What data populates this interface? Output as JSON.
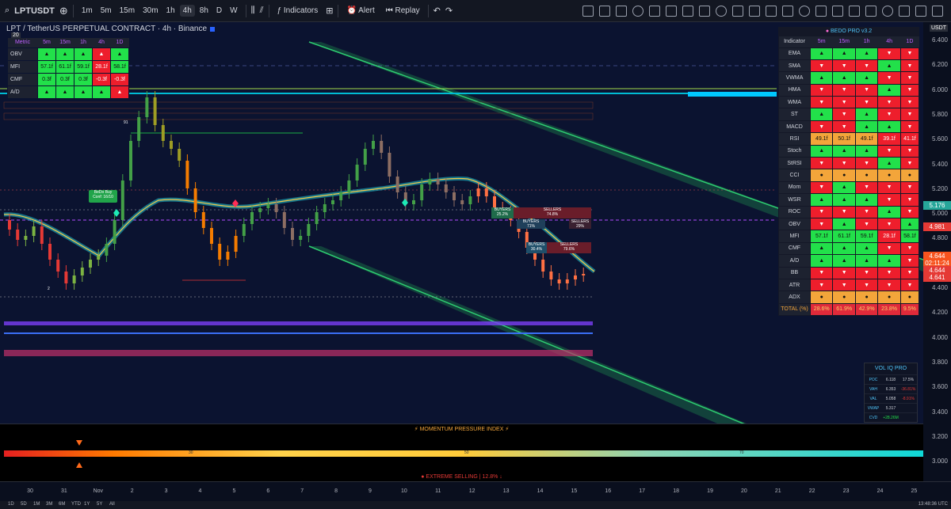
{
  "toolbar": {
    "symbol": "LPTUSDT",
    "intervals": [
      "1m",
      "5m",
      "15m",
      "30m",
      "1h",
      "4h",
      "8h",
      "D",
      "W"
    ],
    "active_interval": "4h",
    "indicators_label": "Indicators",
    "alert_label": "Alert",
    "replay_label": "Replay"
  },
  "chart": {
    "title": "LPT / TetherUS PERPETUAL CONTRACT · 4h · Binance",
    "annotations": {
      "bedo_buy": "BeDo Buy",
      "bedo_conf": "Conf: 16/10",
      "label_91": "91",
      "label_2": "2",
      "buyers_1": "BUYERS",
      "buyers_1_pct": "25.2%",
      "sellers_1": "SELLERS",
      "sellers_1_pct": "74.8%",
      "buyers_2": "BUYERS",
      "buyers_2_pct": "71%",
      "sellers_2": "SELLERS",
      "sellers_2_pct": "29%",
      "buyers_3": "BUYERS",
      "buyers_3_pct": "30.4%",
      "sellers_3": "SELLERS",
      "sellers_3_pct": "79.6%"
    }
  },
  "mini_table": {
    "z_label": "20",
    "header": [
      "Metric",
      "5m",
      "15m",
      "1h",
      "4h",
      "1D"
    ],
    "rows": [
      {
        "label": "OBV",
        "cells": [
          [
            "▲",
            "g"
          ],
          [
            "▲",
            "g"
          ],
          [
            "▲",
            "g"
          ],
          [
            "▲",
            "r"
          ],
          [
            "▲",
            "g"
          ]
        ]
      },
      {
        "label": "MFI",
        "cells": [
          [
            "57.1f",
            "g"
          ],
          [
            "61.1f",
            "g"
          ],
          [
            "59.1f",
            "g"
          ],
          [
            "28.1f",
            "r"
          ],
          [
            "58.1f",
            "g"
          ]
        ]
      },
      {
        "label": "CMF",
        "cells": [
          [
            "0.3f",
            "g"
          ],
          [
            "0.3f",
            "g"
          ],
          [
            "0.3f",
            "g"
          ],
          [
            "-0.3f",
            "r"
          ],
          [
            "-0.3f",
            "r"
          ]
        ]
      },
      {
        "label": "A/D",
        "cells": [
          [
            "▲",
            "g"
          ],
          [
            "▲",
            "g"
          ],
          [
            "▲",
            "g"
          ],
          [
            "▲",
            "g"
          ],
          [
            "▲",
            "r"
          ]
        ]
      }
    ]
  },
  "bedo": {
    "title": "BEDO PRO  v3.2",
    "header": [
      "Indicator",
      "5m",
      "15m",
      "1h",
      "4h",
      "1D"
    ],
    "rows": [
      {
        "label": "EMA",
        "cells": [
          [
            "▲",
            "g"
          ],
          [
            "▲",
            "g"
          ],
          [
            "▲",
            "g"
          ],
          [
            "▼",
            "r"
          ],
          [
            "▼",
            "r"
          ]
        ]
      },
      {
        "label": "SMA",
        "cells": [
          [
            "▼",
            "r"
          ],
          [
            "▼",
            "r"
          ],
          [
            "▼",
            "r"
          ],
          [
            "▲",
            "g"
          ],
          [
            "▼",
            "r"
          ]
        ]
      },
      {
        "label": "VWMA",
        "cells": [
          [
            "▲",
            "g"
          ],
          [
            "▲",
            "g"
          ],
          [
            "▲",
            "g"
          ],
          [
            "▼",
            "r"
          ],
          [
            "▼",
            "r"
          ]
        ]
      },
      {
        "label": "HMA",
        "cells": [
          [
            "▼",
            "r"
          ],
          [
            "▼",
            "r"
          ],
          [
            "▼",
            "r"
          ],
          [
            "▲",
            "g"
          ],
          [
            "▼",
            "r"
          ]
        ]
      },
      {
        "label": "WMA",
        "cells": [
          [
            "▼",
            "r"
          ],
          [
            "▼",
            "r"
          ],
          [
            "▼",
            "r"
          ],
          [
            "▼",
            "r"
          ],
          [
            "▼",
            "r"
          ]
        ]
      },
      {
        "label": "ST",
        "cells": [
          [
            "▲",
            "g"
          ],
          [
            "▼",
            "r"
          ],
          [
            "▲",
            "g"
          ],
          [
            "▼",
            "r"
          ],
          [
            "▼",
            "r"
          ]
        ]
      },
      {
        "label": "MACD",
        "cells": [
          [
            "▼",
            "r"
          ],
          [
            "▼",
            "r"
          ],
          [
            "▲",
            "g"
          ],
          [
            "▲",
            "g"
          ],
          [
            "▼",
            "r"
          ]
        ]
      },
      {
        "label": "RSI",
        "cells": [
          [
            "49.1f",
            "o"
          ],
          [
            "50.1f",
            "o"
          ],
          [
            "49.1f",
            "o"
          ],
          [
            "39.1f",
            "r"
          ],
          [
            "41.1f",
            "r"
          ]
        ]
      },
      {
        "label": "Stoch",
        "cells": [
          [
            "▲",
            "g"
          ],
          [
            "▲",
            "g"
          ],
          [
            "▲",
            "g"
          ],
          [
            "▼",
            "r"
          ],
          [
            "▼",
            "r"
          ]
        ]
      },
      {
        "label": "StRSI",
        "cells": [
          [
            "▼",
            "r"
          ],
          [
            "▼",
            "r"
          ],
          [
            "▼",
            "r"
          ],
          [
            "▲",
            "g"
          ],
          [
            "▼",
            "r"
          ]
        ]
      },
      {
        "label": "CCI",
        "cells": [
          [
            "●",
            "o"
          ],
          [
            "●",
            "o"
          ],
          [
            "●",
            "o"
          ],
          [
            "●",
            "o"
          ],
          [
            "●",
            "o"
          ]
        ]
      },
      {
        "label": "Mom",
        "cells": [
          [
            "▼",
            "r"
          ],
          [
            "▲",
            "g"
          ],
          [
            "▼",
            "r"
          ],
          [
            "▼",
            "r"
          ],
          [
            "▼",
            "r"
          ]
        ]
      },
      {
        "label": "WSR",
        "cells": [
          [
            "▲",
            "g"
          ],
          [
            "▲",
            "g"
          ],
          [
            "▲",
            "g"
          ],
          [
            "▼",
            "r"
          ],
          [
            "▼",
            "r"
          ]
        ]
      },
      {
        "label": "ROC",
        "cells": [
          [
            "▼",
            "r"
          ],
          [
            "▼",
            "r"
          ],
          [
            "▼",
            "r"
          ],
          [
            "▲",
            "g"
          ],
          [
            "▼",
            "r"
          ]
        ]
      },
      {
        "label": "OBV",
        "cells": [
          [
            "▼",
            "r"
          ],
          [
            "▲",
            "g"
          ],
          [
            "▼",
            "r"
          ],
          [
            "▼",
            "r"
          ],
          [
            "▲",
            "g"
          ]
        ]
      },
      {
        "label": "MFI",
        "cells": [
          [
            "57.1f",
            "g"
          ],
          [
            "61.1f",
            "g"
          ],
          [
            "59.1f",
            "g"
          ],
          [
            "28.1f",
            "r"
          ],
          [
            "58.1f",
            "g"
          ]
        ]
      },
      {
        "label": "CMF",
        "cells": [
          [
            "▲",
            "g"
          ],
          [
            "▲",
            "g"
          ],
          [
            "▲",
            "g"
          ],
          [
            "▼",
            "r"
          ],
          [
            "▼",
            "r"
          ]
        ]
      },
      {
        "label": "A/D",
        "cells": [
          [
            "▲",
            "g"
          ],
          [
            "▲",
            "g"
          ],
          [
            "▲",
            "g"
          ],
          [
            "▲",
            "g"
          ],
          [
            "▼",
            "r"
          ]
        ]
      },
      {
        "label": "BB",
        "cells": [
          [
            "▼",
            "r"
          ],
          [
            "▼",
            "r"
          ],
          [
            "▼",
            "r"
          ],
          [
            "▼",
            "r"
          ],
          [
            "▼",
            "r"
          ]
        ]
      },
      {
        "label": "ATR",
        "cells": [
          [
            "▼",
            "r"
          ],
          [
            "▼",
            "r"
          ],
          [
            "▼",
            "r"
          ],
          [
            "▼",
            "r"
          ],
          [
            "▼",
            "r"
          ]
        ]
      },
      {
        "label": "ADX",
        "cells": [
          [
            "●",
            "o"
          ],
          [
            "●",
            "o"
          ],
          [
            "●",
            "o"
          ],
          [
            "●",
            "o"
          ],
          [
            "●",
            "o"
          ]
        ]
      }
    ],
    "total_label": "TOTAL (%)",
    "totals": [
      "28.6%",
      "61.9%",
      "42.9%",
      "23.8%",
      "9.5%"
    ]
  },
  "voliq": {
    "title": "VOL IQ PRO",
    "rows": [
      {
        "k": "POC",
        "v": "6.118",
        "d": "17.5%",
        "dc": ""
      },
      {
        "k": "VAH",
        "v": "6.353",
        "d": "-36.81%",
        "dc": "neg"
      },
      {
        "k": "VAL",
        "v": "5.058",
        "d": "-8.91%",
        "dc": "neg"
      },
      {
        "k": "VWAP",
        "v": "5.317",
        "d": "",
        "dc": ""
      },
      {
        "k": "CVD",
        "v": "+28.26M",
        "d": "",
        "dc": "pos"
      }
    ]
  },
  "mpi": {
    "title": "⚡ MOMENTUM PRESSURE INDEX ⚡",
    "tick_30": "30",
    "tick_50": "50",
    "tick_70": "70",
    "status": "EXTREME SELLING | 12.8% ↓"
  },
  "price_axis": {
    "currency": "USDT",
    "ticks": [
      "6.400",
      "6.200",
      "6.000",
      "5.800",
      "5.600",
      "5.400",
      "5.200",
      "5.000",
      "4.800",
      "4.600",
      "4.400",
      "4.200",
      "4.000",
      "3.800",
      "3.600",
      "3.400",
      "3.200",
      "3.000"
    ],
    "tags": [
      {
        "text": "5.176",
        "color": "#26a69a"
      },
      {
        "text": "4.981",
        "color": "#e53935"
      },
      {
        "text": "4.644",
        "color": "#f7531e"
      },
      {
        "text": "02:11:24",
        "color": "#f7531e"
      },
      {
        "text": "4.644",
        "color": "#e53935"
      },
      {
        "text": "4.641",
        "color": "#e53935"
      }
    ]
  },
  "time_axis": {
    "ticks": [
      "30",
      "31",
      "Nov",
      "2",
      "3",
      "4",
      "5",
      "6",
      "7",
      "8",
      "9",
      "10",
      "11",
      "12",
      "13",
      "14",
      "15",
      "16",
      "17",
      "18",
      "19",
      "20",
      "21",
      "22",
      "23",
      "24",
      "25"
    ]
  },
  "bottom_bar": {
    "ranges": [
      "1D",
      "5D",
      "1M",
      "3M",
      "6M",
      "YTD",
      "1Y",
      "5Y",
      "All"
    ],
    "clock": "13:48:36 UTC"
  },
  "colors": {
    "bull": "#22e04a",
    "bear": "#ee1e2c",
    "neutral": "#f3a53a",
    "channel": "#2ecc71",
    "cyan": "#00bcd4"
  }
}
